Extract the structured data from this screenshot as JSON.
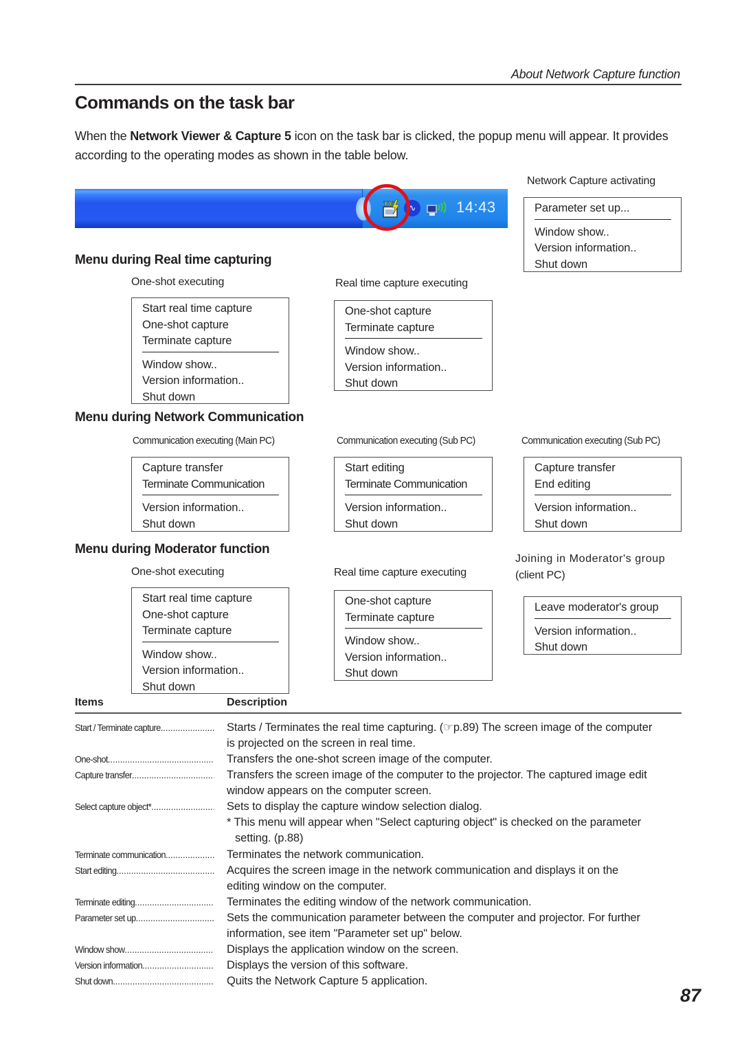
{
  "header": {
    "running_head": "About Network Capture function",
    "title": "Commands on the task bar",
    "intro": {
      "before": "When the ",
      "bold": "Network Viewer & Capture 5",
      "after": " icon on the task bar is clicked, the popup menu will appear. It provides according to the operating modes as shown in the table below."
    }
  },
  "taskbar": {
    "clock": "14:43",
    "icons": [
      "tray-grip-icon",
      "network-capture-tv-icon",
      "network-pulse-icon",
      "wireless-pc-icon"
    ],
    "colors": {
      "taskbar_blue": "#2559f2",
      "tray_blue": "#1f84ec",
      "highlight_ring": "#e0101c"
    }
  },
  "activating": {
    "caption": "Network Capture activating",
    "groups": [
      [
        "Parameter set up..."
      ],
      [
        "Window show..",
        "Version information..",
        "Shut down"
      ]
    ]
  },
  "realtime": {
    "heading": "Menu during Real time capturing",
    "menus": [
      {
        "caption": "One-shot executing",
        "groups": [
          [
            "Start real time capture",
            "One-shot capture",
            "Terminate capture"
          ],
          [
            "Window show..",
            "Version information..",
            "Shut down"
          ]
        ]
      },
      {
        "caption": "Real time capture executing",
        "groups": [
          [
            "One-shot capture",
            "Terminate capture"
          ],
          [
            "Window show..",
            "Version information..",
            "Shut down"
          ]
        ]
      }
    ]
  },
  "network": {
    "heading": "Menu during Network Communication",
    "menus": [
      {
        "caption": "Communication executing (Main PC)",
        "groups": [
          [
            "Capture transfer",
            "Terminate Communication"
          ],
          [
            "Version information..",
            "Shut down"
          ]
        ]
      },
      {
        "caption": "Communication executing (Sub PC)",
        "groups": [
          [
            "Start editing",
            "Terminate Communication"
          ],
          [
            "Version information..",
            "Shut down"
          ]
        ]
      },
      {
        "caption": "Communication executing (Sub PC)",
        "groups": [
          [
            "Capture transfer",
            "End editing"
          ],
          [
            "Version information..",
            "Shut down"
          ]
        ]
      }
    ]
  },
  "moderator": {
    "heading": "Menu during Moderator function",
    "menus": [
      {
        "caption": "One-shot executing",
        "groups": [
          [
            "Start real time capture",
            "One-shot capture",
            "Terminate capture"
          ],
          [
            "Window show..",
            "Version information..",
            "Shut down"
          ]
        ]
      },
      {
        "caption": "Real time capture executing",
        "groups": [
          [
            "One-shot capture",
            "Terminate capture"
          ],
          [
            "Window show..",
            "Version information..",
            "Shut down"
          ]
        ]
      },
      {
        "caption_line1": "Joining in Moderator's group",
        "caption_line2": "(client PC)",
        "groups": [
          [
            "Leave moderator's group"
          ],
          [
            "Version information..",
            "Shut down"
          ]
        ]
      }
    ]
  },
  "table": {
    "headers": {
      "items": "Items",
      "description": "Description"
    },
    "rows": [
      {
        "item": "Start  / Terminate capture",
        "lines": [
          "Starts / Terminates the real time capturing. (☞p.89) The screen image of the computer",
          "is projected on the screen in real time."
        ]
      },
      {
        "item": "One-shot",
        "lines": [
          "Transfers the one-shot screen image of the computer."
        ]
      },
      {
        "item": "Capture transfer",
        "lines": [
          "Transfers the screen image of the computer to the projector. The captured image edit",
          "window appears on the computer screen."
        ]
      },
      {
        "item": "Select capture object*",
        "lines": [
          "Sets to display the capture window selection dialog.",
          "* This menu will appear when \"Select capturing object\" is checked on the parameter",
          "setting. (p.88)"
        ]
      },
      {
        "item": "Terminate communication",
        "lines": [
          "Terminates the network communication."
        ]
      },
      {
        "item": "Start editing",
        "lines": [
          "Acquires the screen image in the network communication and displays it on the",
          "editing window on the computer."
        ]
      },
      {
        "item": "Terminate editing",
        "lines": [
          "Terminates the editing window of the network communication."
        ]
      },
      {
        "item": "Parameter set up",
        "lines": [
          "Sets the communication parameter between the computer and projector. For further",
          "information, see item \"Parameter set up\" below."
        ]
      },
      {
        "item": "Window show",
        "lines": [
          "Displays the application window on the screen."
        ]
      },
      {
        "item": "Version information",
        "lines": [
          "Displays the version of this software."
        ]
      },
      {
        "item": "Shut down",
        "lines": [
          "Quits the Network Capture 5 application."
        ]
      }
    ]
  },
  "footer": {
    "page_number": "87"
  }
}
